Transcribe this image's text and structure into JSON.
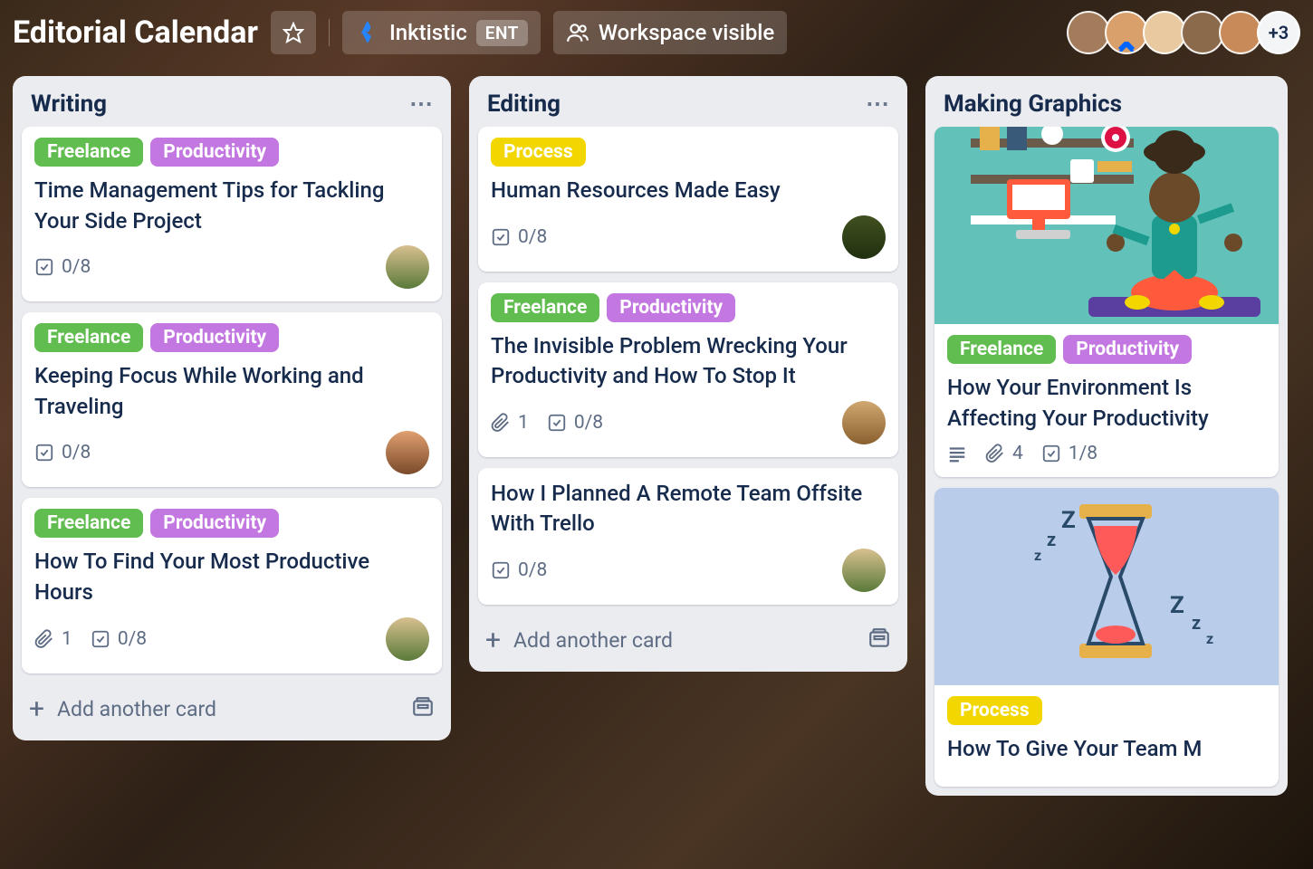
{
  "header": {
    "boardTitle": "Editorial Calendar",
    "workspaceName": "Inktistic",
    "workspaceBadge": "ENT",
    "visibility": "Workspace visible",
    "extraMembers": "+3"
  },
  "colors": {
    "green": "#61bd4f",
    "purple": "#c377e0",
    "yellow": "#f2d600"
  },
  "labels": {
    "freelance": "Freelance",
    "productivity": "Productivity",
    "process": "Process"
  },
  "lists": [
    {
      "title": "Writing",
      "hasMenu": true,
      "footer": "Add another card",
      "cards": [
        {
          "labels": [
            "freelance",
            "productivity"
          ],
          "title": "Time Management Tips for Tackling Your Side Project",
          "checklist": "0/8",
          "avatar": "card-av1"
        },
        {
          "labels": [
            "freelance",
            "productivity"
          ],
          "title": "Keeping Focus While Working and Traveling",
          "checklist": "0/8",
          "avatar": "card-av2"
        },
        {
          "labels": [
            "freelance",
            "productivity"
          ],
          "title": "How To Find Your Most Productive Hours",
          "attachments": "1",
          "checklist": "0/8",
          "avatar": "card-av1"
        }
      ]
    },
    {
      "title": "Editing",
      "hasMenu": true,
      "footer": "Add another card",
      "cards": [
        {
          "labels": [
            "process"
          ],
          "title": "Human Resources Made Easy",
          "checklist": "0/8",
          "avatar": "card-av3"
        },
        {
          "labels": [
            "freelance",
            "productivity"
          ],
          "title": "The Invisible Problem Wrecking Your Productivity and How To Stop It",
          "attachments": "1",
          "checklist": "0/8",
          "avatar": "card-av4"
        },
        {
          "labels": [],
          "title": "How I Planned A Remote Team Offsite With Trello",
          "checklist": "0/8",
          "avatar": "card-av1"
        }
      ]
    },
    {
      "title": "Making Graphics",
      "hasMenu": false,
      "cards": [
        {
          "cover": "teal",
          "labels": [
            "freelance",
            "productivity"
          ],
          "title": "How Your Environment Is Affecting Your Productivity",
          "description": true,
          "attachments": "4",
          "checklist": "1/8"
        },
        {
          "cover": "blue",
          "labels": [
            "process"
          ],
          "title": "How To Give Your Team M"
        }
      ]
    }
  ]
}
